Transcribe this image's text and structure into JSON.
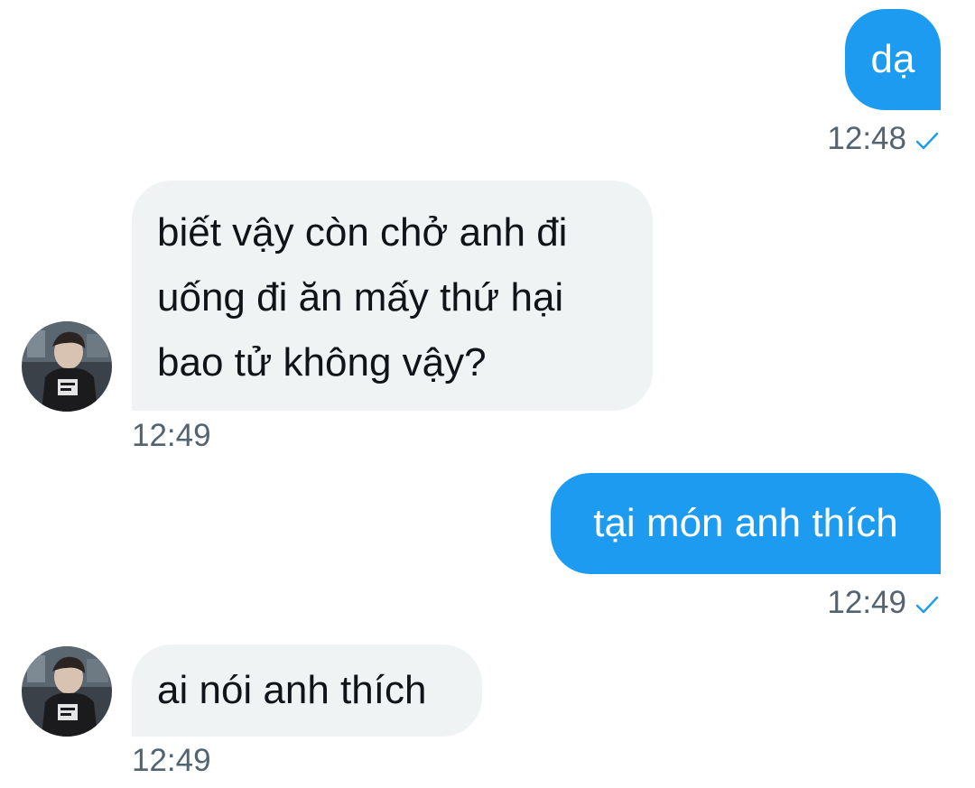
{
  "conversation": {
    "messages": [
      {
        "direction": "sent",
        "text": "dạ",
        "time": "12:48",
        "read_icon": "check-icon"
      },
      {
        "direction": "received",
        "lines": [
          "biết vậy còn chở anh đi",
          "uống đi ăn mấy thứ hại",
          "bao tử không vậy?"
        ],
        "time": "12:49",
        "avatar_icon": "avatar-photo"
      },
      {
        "direction": "sent",
        "text": "tại món anh thích",
        "time": "12:49",
        "read_icon": "check-icon"
      },
      {
        "direction": "received",
        "text": "ai nói anh thích",
        "time": "12:49",
        "avatar_icon": "avatar-photo"
      }
    ]
  },
  "colors": {
    "sent_bubble": "#1d9bf0",
    "received_bubble": "#eff3f4",
    "timestamp": "#536471",
    "check": "#1d9bf0"
  }
}
